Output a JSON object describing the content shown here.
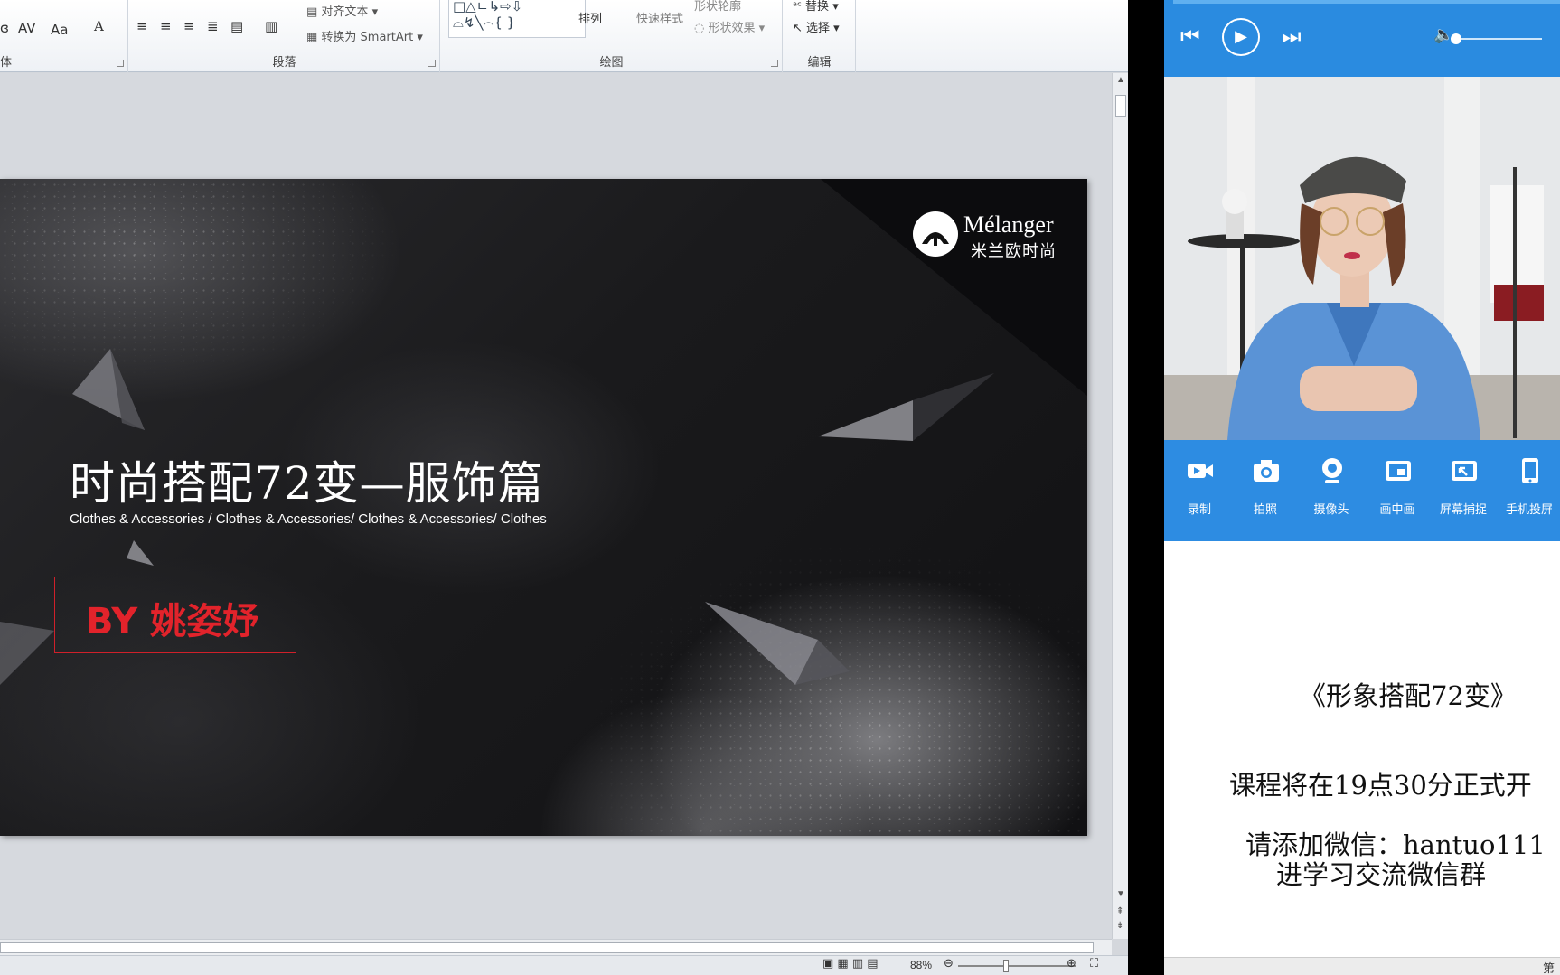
{
  "ribbon": {
    "groups": {
      "font_fragment": "体",
      "paragraph": "段落",
      "drawing": "绘图",
      "editing": "编辑"
    },
    "font_glyphs": {
      "spacing": "AV",
      "case": "Aa",
      "size": "A"
    },
    "align_text": "对齐文本",
    "convert_smartart": "转换为 SmartArt",
    "arrange": "排列",
    "quick_styles": "快速样式",
    "shape_outline": "形状轮廓",
    "shape_effects": "形状效果",
    "replace": "替换",
    "select": "选择"
  },
  "status_bar": {
    "zoom": "88%"
  },
  "slide": {
    "logo_wordmark": "Mélanger",
    "logo_sub": "米兰欧时尚",
    "title": "时尚搭配72变—服饰篇",
    "subtitle": "Clothes & Accessories / Clothes & Accessories/ Clothes & Accessories/ Clothes",
    "byline": "BY 姚姿妤"
  },
  "live_panel": {
    "tools": [
      {
        "icon": "video-camera-icon",
        "label": "录制"
      },
      {
        "icon": "camera-icon",
        "label": "拍照"
      },
      {
        "icon": "webcam-icon",
        "label": "摄像头"
      },
      {
        "icon": "picture-in-picture-icon",
        "label": "画中画"
      },
      {
        "icon": "screen-capture-icon",
        "label": "屏幕捕捉"
      },
      {
        "icon": "phone-icon",
        "label": "手机投屏"
      }
    ],
    "notice": {
      "course": "《形象搭配72变》",
      "start": "课程将在19点30分正式开",
      "wechat": "请添加微信：hantuo111",
      "group": "进学习交流微信群"
    },
    "footer": "第"
  },
  "colors": {
    "accent_blue": "#2d8ce2",
    "byline_red": "#e2232b"
  }
}
